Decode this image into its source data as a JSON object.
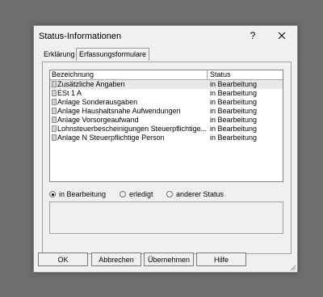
{
  "dialog": {
    "title": "Status-Informationen",
    "help_label": "?",
    "close_icon": "close-icon"
  },
  "tabs": [
    {
      "label": "Erklärung",
      "selected": false
    },
    {
      "label": "Erfassungsformulare",
      "selected": true
    }
  ],
  "list": {
    "columns": [
      "Bezeichnung",
      "Status"
    ],
    "rows": [
      {
        "name": "Zusätzliche Angaben",
        "status": "in Bearbeitung"
      },
      {
        "name": "ESt 1 A",
        "status": "in Bearbeitung"
      },
      {
        "name": "Anlage Sonderausgaben",
        "status": "in Bearbeitung"
      },
      {
        "name": "Anlage Haushaltsnahe Aufwendungen",
        "status": "in Bearbeitung"
      },
      {
        "name": "Anlage Vorsorgeaufwand",
        "status": "in Bearbeitung"
      },
      {
        "name": "Lohnsteuerbescheinigungen Steuerpflichtige...",
        "status": "in Bearbeitung"
      },
      {
        "name": "Anlage N Steuerpflichtige Person",
        "status": "in Bearbeitung"
      }
    ]
  },
  "status_filter": {
    "options": [
      "in Bearbeitung",
      "erledigt",
      "anderer Status"
    ],
    "selected": "in Bearbeitung"
  },
  "buttons": {
    "ok": "OK",
    "cancel": "Abbrechen",
    "apply": "Übernehmen",
    "help": "Hilfe"
  }
}
